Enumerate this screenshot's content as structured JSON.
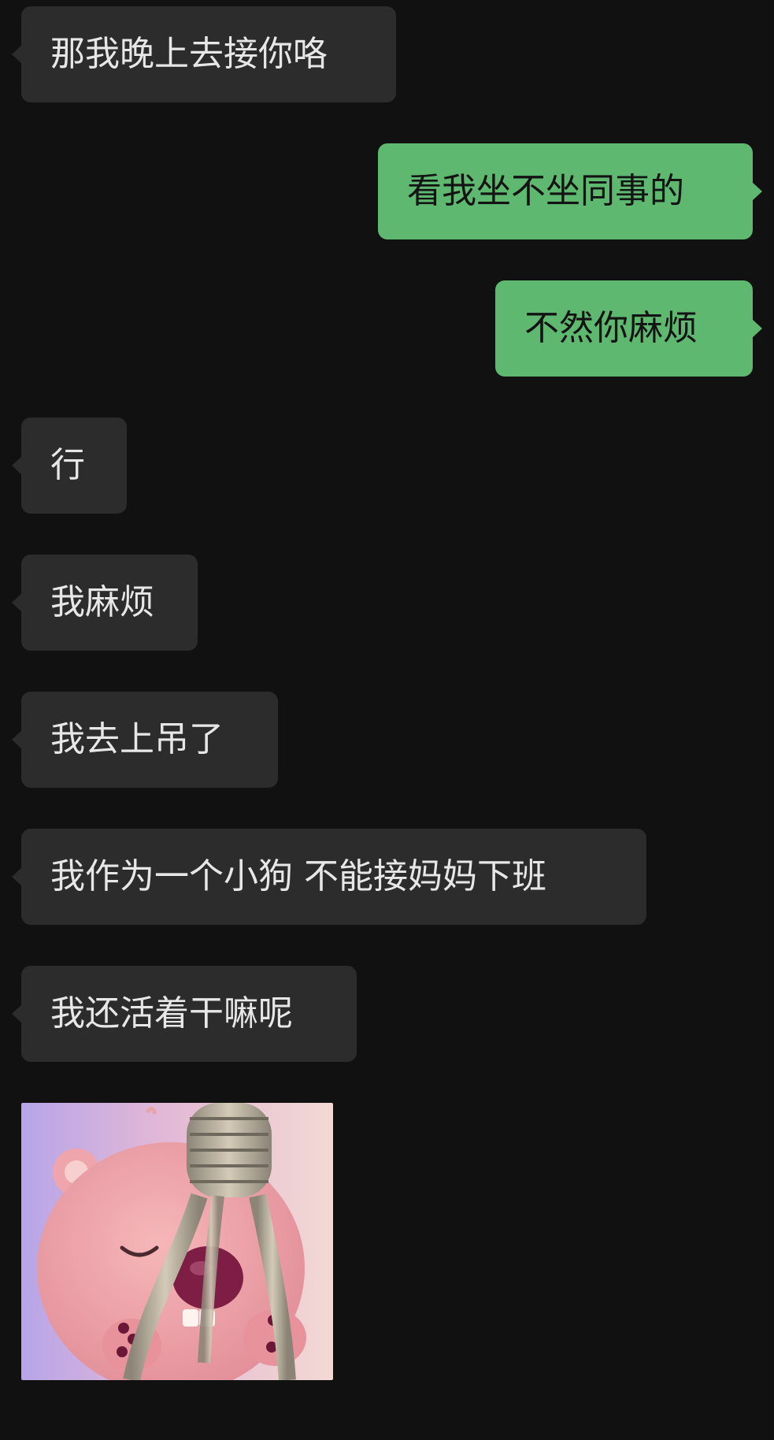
{
  "conversation": {
    "messages": [
      {
        "side": "in",
        "text": "那我晚上去接你咯"
      },
      {
        "side": "out",
        "text": "看我坐不坐同事的"
      },
      {
        "side": "out",
        "text": "不然你麻烦"
      },
      {
        "side": "in",
        "text": "行"
      },
      {
        "side": "in",
        "text": "我麻烦"
      },
      {
        "side": "in",
        "text": "我去上吊了"
      },
      {
        "side": "in",
        "text": "我作为一个小狗 不能接妈妈下班"
      },
      {
        "side": "in",
        "text": "我还活着干嘛呢"
      }
    ],
    "sticker": {
      "icon": "pink-beaver-with-noose-sticker"
    }
  },
  "colors": {
    "background": "#111111",
    "incoming_bubble": "#2c2c2c",
    "outgoing_bubble": "#5fb870"
  }
}
